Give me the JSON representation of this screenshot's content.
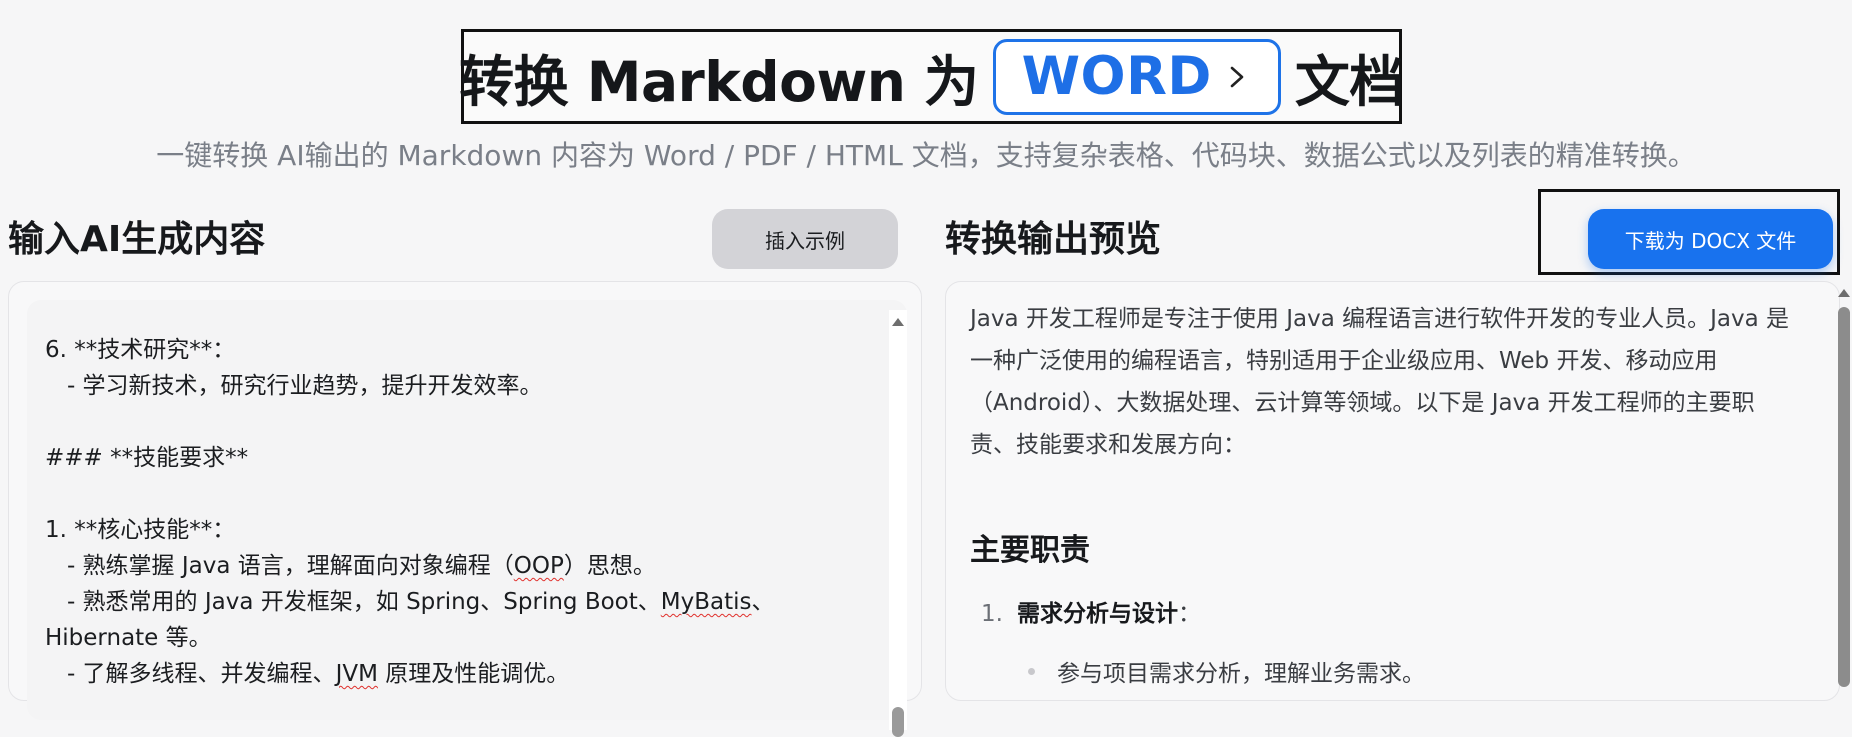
{
  "header": {
    "title_prefix": "转换 Markdown 为",
    "title_highlight": "WORD",
    "title_suffix": "文档",
    "subtitle": "一键转换 AI输出的 Markdown 内容为 Word / PDF / HTML 文档，支持复杂表格、代码块、数据公式以及列表的精准转换。"
  },
  "editor": {
    "title": "输入AI生成内容",
    "example_button": "插入示例",
    "lines": [
      "6. **技术研究**：",
      "   - 学习新技术，研究行业趋势，提升开发效率。",
      "",
      "### **技能要求**",
      "",
      "1. **核心技能**：",
      "   - 熟练掌握 Java 语言，理解面向对象编程（",
      "OOP",
      "）思想。",
      "   - 熟悉常用的 Java 开发框架，如 Spring、Spring Boot、",
      "MyBatis",
      "、",
      "Hibernate 等。",
      "   - 了解多线程、并发编程、",
      "JVM",
      " 原理及性能调优。"
    ]
  },
  "preview": {
    "title": "转换输出预览",
    "download_button": "下载为 DOCX 文件",
    "intro": "Java 开发工程师是专注于使用 Java 编程语言进行软件开发的专业人员。Java 是一种广泛使用的编程语言，特别适用于企业级应用、Web 开发、移动应用（Android）、大数据处理、云计算等领域。以下是 Java 开发工程师的主要职责、技能要求和发展方向：",
    "section_heading": "主要职责",
    "list_item_number": "1.",
    "list_item_title": "需求分析与设计",
    "list_item_colon": "：",
    "sub_item": "参与项目需求分析，理解业务需求。"
  },
  "colors": {
    "accent": "#1872ee",
    "highlight_border": "#1e73e8",
    "spell_error": "#e0302c"
  },
  "icons": {
    "pill": "chevron-right-icon",
    "scroll_up": "scroll-up-arrow-icon"
  }
}
